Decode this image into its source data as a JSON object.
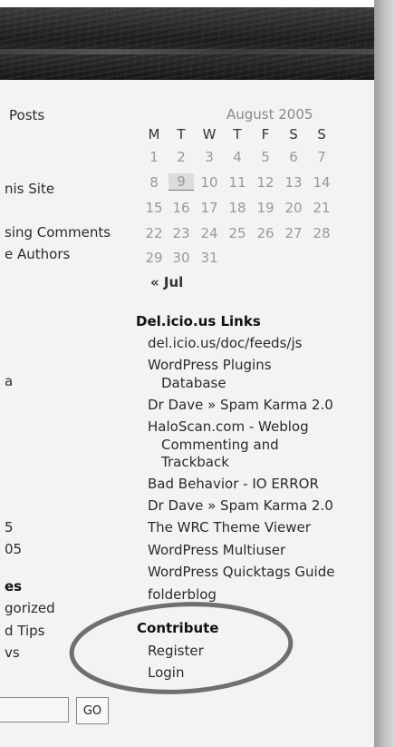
{
  "left_column": {
    "posts_label": "Posts",
    "site_label": "nis Site",
    "comments_label": "sing Comments",
    "authors_label": "e Authors",
    "a_label": "a",
    "item5": "5",
    "item05": "05",
    "es_heading": "es",
    "gorized": "gorized",
    "tips": "d Tips",
    "vs": "vs"
  },
  "calendar": {
    "caption": "August 2005",
    "days": [
      "M",
      "T",
      "W",
      "T",
      "F",
      "S",
      "S"
    ],
    "weeks": [
      [
        "1",
        "2",
        "3",
        "4",
        "5",
        "6",
        "7"
      ],
      [
        "8",
        "9",
        "10",
        "11",
        "12",
        "13",
        "14"
      ],
      [
        "15",
        "16",
        "17",
        "18",
        "19",
        "20",
        "21"
      ],
      [
        "22",
        "23",
        "24",
        "25",
        "26",
        "27",
        "28"
      ],
      [
        "29",
        "30",
        "31",
        "",
        "",
        "",
        ""
      ]
    ],
    "today": "9",
    "prev_link": "« Jul"
  },
  "delicious": {
    "heading": "Del.icio.us Links",
    "links": [
      {
        "line1": "del.icio.us/doc/feeds/js"
      },
      {
        "line1": "WordPress Plugins",
        "line2": "Database"
      },
      {
        "line1": "Dr Dave » Spam Karma 2.0"
      },
      {
        "line1": "HaloScan.com - Weblog",
        "line2": "Commenting and",
        "line3": "Trackback"
      },
      {
        "line1": "Bad Behavior - IO ERROR"
      },
      {
        "line1": "Dr Dave » Spam Karma 2.0"
      },
      {
        "line1": "The WRC Theme Viewer"
      },
      {
        "line1": "WordPress Multiuser"
      },
      {
        "line1": "WordPress Quicktags Guide"
      },
      {
        "line1": "folderblog"
      }
    ]
  },
  "contribute": {
    "heading": "Contribute",
    "register": "Register",
    "login": "Login"
  },
  "search": {
    "placeholder": "",
    "go_label": "GO"
  }
}
